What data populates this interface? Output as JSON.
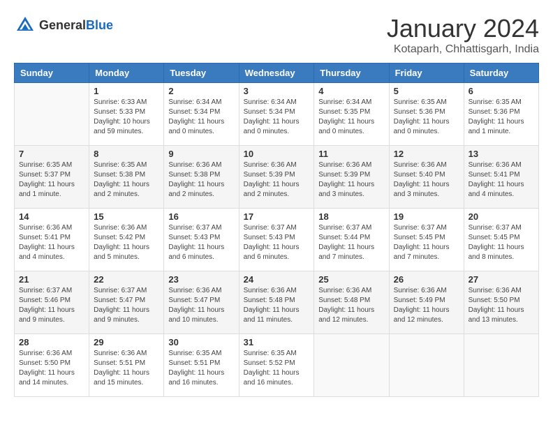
{
  "header": {
    "logo": {
      "general": "General",
      "blue": "Blue"
    },
    "title": "January 2024",
    "location": "Kotaparh, Chhattisgarh, India"
  },
  "calendar": {
    "weekdays": [
      "Sunday",
      "Monday",
      "Tuesday",
      "Wednesday",
      "Thursday",
      "Friday",
      "Saturday"
    ],
    "weeks": [
      [
        {
          "day": "",
          "info": ""
        },
        {
          "day": "1",
          "info": "Sunrise: 6:33 AM\nSunset: 5:33 PM\nDaylight: 10 hours\nand 59 minutes."
        },
        {
          "day": "2",
          "info": "Sunrise: 6:34 AM\nSunset: 5:34 PM\nDaylight: 11 hours\nand 0 minutes."
        },
        {
          "day": "3",
          "info": "Sunrise: 6:34 AM\nSunset: 5:34 PM\nDaylight: 11 hours\nand 0 minutes."
        },
        {
          "day": "4",
          "info": "Sunrise: 6:34 AM\nSunset: 5:35 PM\nDaylight: 11 hours\nand 0 minutes."
        },
        {
          "day": "5",
          "info": "Sunrise: 6:35 AM\nSunset: 5:36 PM\nDaylight: 11 hours\nand 0 minutes."
        },
        {
          "day": "6",
          "info": "Sunrise: 6:35 AM\nSunset: 5:36 PM\nDaylight: 11 hours\nand 1 minute."
        }
      ],
      [
        {
          "day": "7",
          "info": "Sunrise: 6:35 AM\nSunset: 5:37 PM\nDaylight: 11 hours\nand 1 minute."
        },
        {
          "day": "8",
          "info": "Sunrise: 6:35 AM\nSunset: 5:38 PM\nDaylight: 11 hours\nand 2 minutes."
        },
        {
          "day": "9",
          "info": "Sunrise: 6:36 AM\nSunset: 5:38 PM\nDaylight: 11 hours\nand 2 minutes."
        },
        {
          "day": "10",
          "info": "Sunrise: 6:36 AM\nSunset: 5:39 PM\nDaylight: 11 hours\nand 2 minutes."
        },
        {
          "day": "11",
          "info": "Sunrise: 6:36 AM\nSunset: 5:39 PM\nDaylight: 11 hours\nand 3 minutes."
        },
        {
          "day": "12",
          "info": "Sunrise: 6:36 AM\nSunset: 5:40 PM\nDaylight: 11 hours\nand 3 minutes."
        },
        {
          "day": "13",
          "info": "Sunrise: 6:36 AM\nSunset: 5:41 PM\nDaylight: 11 hours\nand 4 minutes."
        }
      ],
      [
        {
          "day": "14",
          "info": "Sunrise: 6:36 AM\nSunset: 5:41 PM\nDaylight: 11 hours\nand 4 minutes."
        },
        {
          "day": "15",
          "info": "Sunrise: 6:36 AM\nSunset: 5:42 PM\nDaylight: 11 hours\nand 5 minutes."
        },
        {
          "day": "16",
          "info": "Sunrise: 6:37 AM\nSunset: 5:43 PM\nDaylight: 11 hours\nand 6 minutes."
        },
        {
          "day": "17",
          "info": "Sunrise: 6:37 AM\nSunset: 5:43 PM\nDaylight: 11 hours\nand 6 minutes."
        },
        {
          "day": "18",
          "info": "Sunrise: 6:37 AM\nSunset: 5:44 PM\nDaylight: 11 hours\nand 7 minutes."
        },
        {
          "day": "19",
          "info": "Sunrise: 6:37 AM\nSunset: 5:45 PM\nDaylight: 11 hours\nand 7 minutes."
        },
        {
          "day": "20",
          "info": "Sunrise: 6:37 AM\nSunset: 5:45 PM\nDaylight: 11 hours\nand 8 minutes."
        }
      ],
      [
        {
          "day": "21",
          "info": "Sunrise: 6:37 AM\nSunset: 5:46 PM\nDaylight: 11 hours\nand 9 minutes."
        },
        {
          "day": "22",
          "info": "Sunrise: 6:37 AM\nSunset: 5:47 PM\nDaylight: 11 hours\nand 9 minutes."
        },
        {
          "day": "23",
          "info": "Sunrise: 6:36 AM\nSunset: 5:47 PM\nDaylight: 11 hours\nand 10 minutes."
        },
        {
          "day": "24",
          "info": "Sunrise: 6:36 AM\nSunset: 5:48 PM\nDaylight: 11 hours\nand 11 minutes."
        },
        {
          "day": "25",
          "info": "Sunrise: 6:36 AM\nSunset: 5:48 PM\nDaylight: 11 hours\nand 12 minutes."
        },
        {
          "day": "26",
          "info": "Sunrise: 6:36 AM\nSunset: 5:49 PM\nDaylight: 11 hours\nand 12 minutes."
        },
        {
          "day": "27",
          "info": "Sunrise: 6:36 AM\nSunset: 5:50 PM\nDaylight: 11 hours\nand 13 minutes."
        }
      ],
      [
        {
          "day": "28",
          "info": "Sunrise: 6:36 AM\nSunset: 5:50 PM\nDaylight: 11 hours\nand 14 minutes."
        },
        {
          "day": "29",
          "info": "Sunrise: 6:36 AM\nSunset: 5:51 PM\nDaylight: 11 hours\nand 15 minutes."
        },
        {
          "day": "30",
          "info": "Sunrise: 6:35 AM\nSunset: 5:51 PM\nDaylight: 11 hours\nand 16 minutes."
        },
        {
          "day": "31",
          "info": "Sunrise: 6:35 AM\nSunset: 5:52 PM\nDaylight: 11 hours\nand 16 minutes."
        },
        {
          "day": "",
          "info": ""
        },
        {
          "day": "",
          "info": ""
        },
        {
          "day": "",
          "info": ""
        }
      ]
    ]
  }
}
